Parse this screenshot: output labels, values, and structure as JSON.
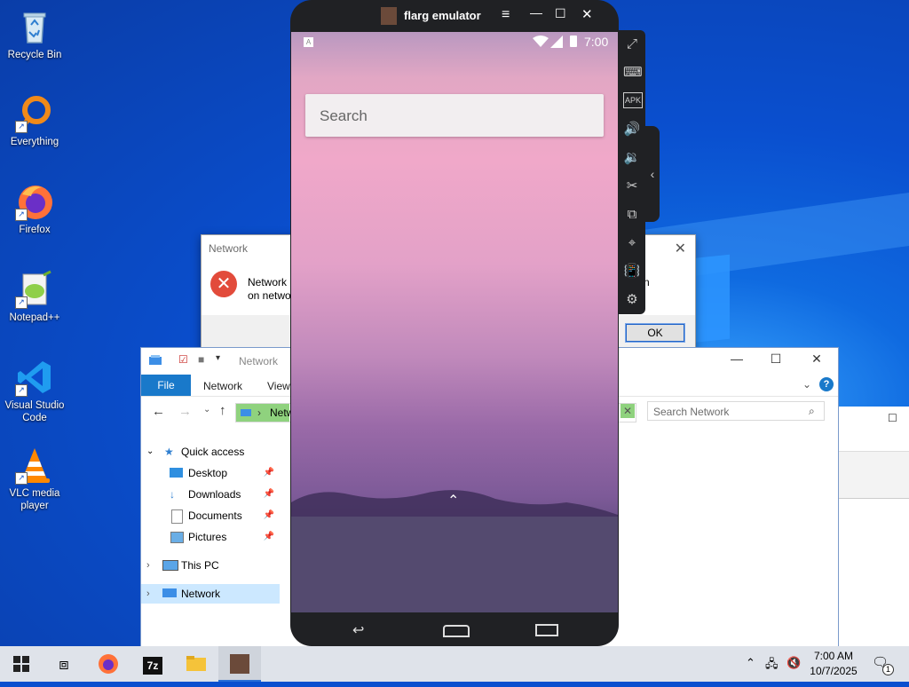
{
  "desktop": {
    "icons": [
      {
        "label": "Recycle Bin"
      },
      {
        "label": "Everything"
      },
      {
        "label": "Firefox"
      },
      {
        "label": "Notepad++"
      },
      {
        "label": "Visual Studio Code"
      },
      {
        "label": "VLC media player"
      }
    ]
  },
  "error_dialog": {
    "title": "Network",
    "message_left_1": "Network",
    "message_left_2": "on netwo",
    "message_right": "e turn",
    "ok_label": "OK",
    "close_glyph": "✕"
  },
  "explorer": {
    "title": "Network",
    "tabs": {
      "file": "File",
      "network": "Network",
      "view": "View"
    },
    "address": "Netw",
    "search_placeholder": "Search Network",
    "nav": {
      "quick_access": "Quick access",
      "items": [
        {
          "label": "Desktop"
        },
        {
          "label": "Downloads"
        },
        {
          "label": "Documents"
        },
        {
          "label": "Pictures"
        }
      ],
      "this_pc": "This PC",
      "network": "Network"
    }
  },
  "emulator": {
    "title": "flarg emulator",
    "status_time": "7:00",
    "status_left_badge": "A",
    "search_placeholder": "Search"
  },
  "taskbar": {
    "time": "7:00 AM",
    "date": "10/7/2025",
    "notification_count": "1",
    "seven_zip_label": "7z"
  }
}
